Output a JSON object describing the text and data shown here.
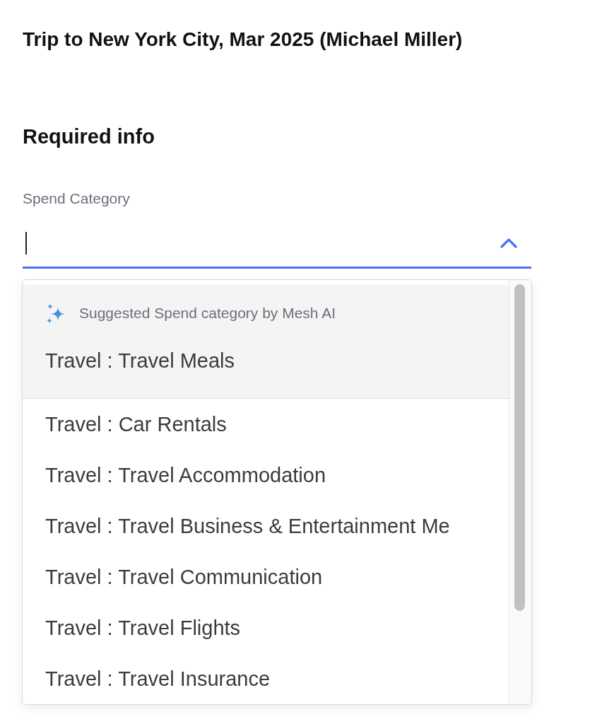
{
  "page": {
    "title": "Trip to New York City, Mar 2025 (Michael Miller)"
  },
  "section": {
    "heading": "Required info"
  },
  "field": {
    "label": "Spend Category",
    "focused": true,
    "expanded": true
  },
  "dropdown": {
    "suggestion": {
      "caption": "Suggested Spend category by Mesh AI",
      "option": "Travel : Travel Meals"
    },
    "options": [
      {
        "label": "Travel : Car Rentals",
        "selected": false
      },
      {
        "label": "Travel : Travel Accommodation",
        "selected": false
      },
      {
        "label": "Travel : Travel Business & Entertainment Me",
        "selected": false
      },
      {
        "label": "Travel : Travel Communication",
        "selected": false
      },
      {
        "label": "Travel : Travel Flights",
        "selected": false
      },
      {
        "label": "Travel : Travel Insurance",
        "selected": false
      }
    ]
  }
}
